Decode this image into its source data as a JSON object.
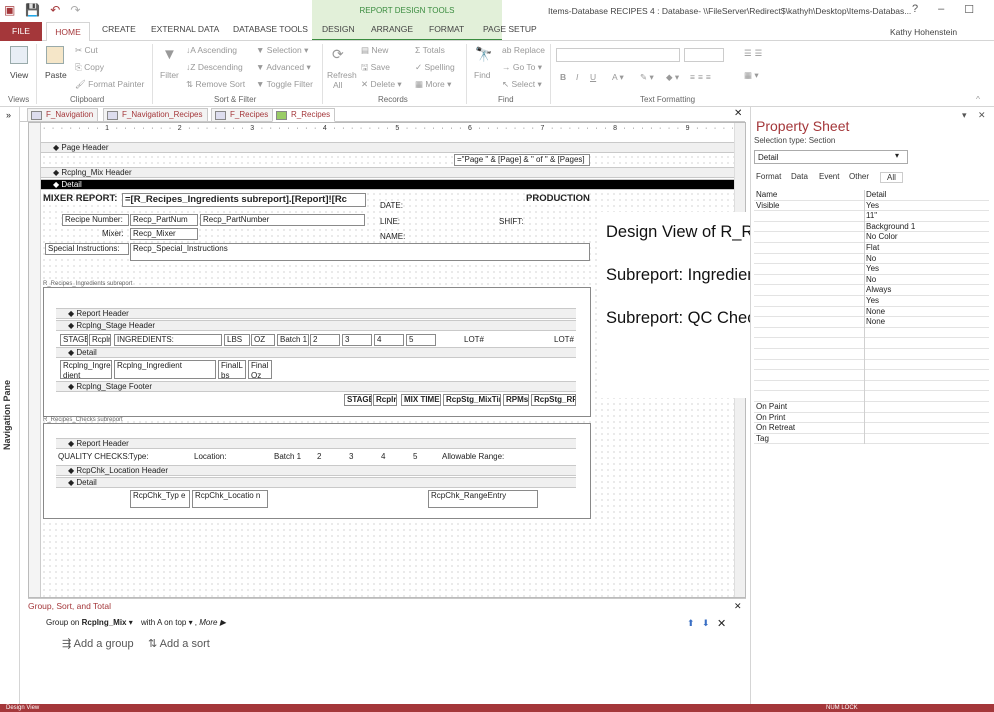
{
  "window": {
    "context_tab_group": "REPORT DESIGN TOOLS",
    "title": "Items-Database RECIPES 4 : Database- \\\\FileServer\\Redirect$\\kathyh\\Desktop\\Items-Databas...",
    "user": "Kathy Hohenstein",
    "controls": [
      "?",
      "–",
      "☐",
      "✕"
    ]
  },
  "ribbon_tabs": [
    "FILE",
    "HOME",
    "CREATE",
    "EXTERNAL DATA",
    "DATABASE TOOLS",
    "DESIGN",
    "ARRANGE",
    "FORMAT",
    "PAGE SETUP"
  ],
  "ribbon": {
    "views": {
      "view": "View",
      "group": "Views"
    },
    "clipboard": {
      "paste": "Paste",
      "cut": "Cut",
      "copy": "Copy",
      "format_painter": "Format Painter",
      "group": "Clipboard"
    },
    "sort_filter": {
      "filter": "Filter",
      "ascending": "Ascending",
      "descending": "Descending",
      "remove_sort": "Remove Sort",
      "selection": "Selection",
      "advanced": "Advanced",
      "toggle_filter": "Toggle Filter",
      "group": "Sort & Filter"
    },
    "records": {
      "refresh": "Refresh",
      "refresh_all": "All",
      "new": "New",
      "save": "Save",
      "delete": "Delete",
      "totals": "Totals",
      "spelling": "Spelling",
      "more": "More",
      "group": "Records"
    },
    "find": {
      "find": "Find",
      "replace": "Replace",
      "goto": "Go To",
      "select": "Select",
      "group": "Find"
    },
    "text_formatting": {
      "group": "Text Formatting"
    }
  },
  "navigation_pane": {
    "label": "Navigation Pane",
    "collapse": "»"
  },
  "document_tabs": [
    {
      "label": "F_Navigation"
    },
    {
      "label": "F_Navigation_Recipes"
    },
    {
      "label": "F_Recipes"
    },
    {
      "label": "R_Recipes",
      "active": true
    }
  ],
  "report": {
    "ruler_top": "· · · · · · · 1 · · · · · · · 2 · · · · · · · 3 · · · · · · · 4 · · · · · · · 5 · · · · · · · 6 · · · · · · · 7 · · · · · · · 8 · · · · · · · 9 · · · · · · · 10",
    "sections": {
      "page_header": "Page Header",
      "mix_header": "Rcplng_Mix Header",
      "detail": "Detail"
    },
    "page_expr": "=\"Page \" & [Page] & \" of \" & [Pages]",
    "mixer_report_label": "MIXER REPORT:",
    "mixer_report_expr": "=[R_Recipes_Ingredients subreport].[Report]![Rc",
    "production_label": "PRODUCTION",
    "date_label": "DATE:",
    "line_label": "LINE:",
    "shift_label": "SHIFT:",
    "name_label": "NAME:",
    "recipe_number_label": "Recipe Number:",
    "recipe_partnum": "Recp_PartNum",
    "recipe_partnumber": "Recp_PartNumber",
    "mixer_label": "Mixer:",
    "recipe_mixer": "Recp_Mixer",
    "special_instructions_label": "Special Instructions:",
    "special_instructions": "Recp_Special_Instructions",
    "ingredients_sub_label": "R_Recipes_Ingredients subreport",
    "ingredients_sub": {
      "report_header": "Report Header",
      "stage_header": "Rcplng_Stage Header",
      "stage_row": [
        "STAGE",
        "Rcplr",
        "INGREDIENTS:",
        "LBS",
        "OZ",
        "Batch 1",
        "2",
        "3",
        "4",
        "5",
        "LOT#",
        "LOT#"
      ],
      "detail": "Detail",
      "detail_row": [
        "Rcplng_Ingre dient",
        "Rcplng_Ingredient",
        "FinalL bs",
        "Final Oz"
      ],
      "stage_footer": "Rcplng_Stage Footer",
      "footer_row": [
        "STAGE",
        "Rcplr",
        "MIX TIME:",
        "RcpStg_MixTim",
        "RPMs:",
        "RcpStg_RPI"
      ]
    },
    "checks_sub_label": "R_Recipes_Checks subreport",
    "checks_sub": {
      "report_header": "Report Header",
      "header_row": [
        "QUALITY CHECKS:",
        "Type:",
        "Location:",
        "Batch 1",
        "2",
        "3",
        "4",
        "5",
        "Allowable Range:"
      ],
      "location_header": "RcpChk_Location Header",
      "detail": "Detail",
      "detail_row": [
        "RcpChk_Typ e",
        "RcpChk_Locatio n",
        "RcpChk_RangeEntry"
      ]
    }
  },
  "overlay": {
    "line1": "Design View of R_Recipes",
    "line2": "Subreport: Ingredients",
    "line3": "Subreport: QC Checks"
  },
  "property_sheet": {
    "title": "Property Sheet",
    "selection_type": "Selection type:  Section",
    "selected": "Detail",
    "tabs": [
      "Format",
      "Data",
      "Event",
      "Other",
      "All"
    ],
    "rows": [
      [
        "Name",
        "Detail"
      ],
      [
        "Visible",
        "Yes"
      ],
      [
        "",
        "11\""
      ],
      [
        "",
        "Background 1"
      ],
      [
        "",
        "No Color"
      ],
      [
        "",
        "Flat"
      ],
      [
        "",
        "No"
      ],
      [
        "",
        "Yes"
      ],
      [
        "",
        "No"
      ],
      [
        "",
        "Always"
      ],
      [
        "",
        "Yes"
      ],
      [
        "",
        "None"
      ],
      [
        "",
        "None"
      ],
      [
        "",
        ""
      ],
      [
        "",
        ""
      ],
      [
        "",
        ""
      ],
      [
        "",
        ""
      ],
      [
        "",
        ""
      ],
      [
        "",
        ""
      ],
      [
        "",
        ""
      ],
      [
        "On Paint",
        ""
      ],
      [
        "On Print",
        ""
      ],
      [
        "On Retreat",
        ""
      ],
      [
        "Tag",
        ""
      ]
    ]
  },
  "group_sort": {
    "title": "Group, Sort, and Total",
    "group_on": "Group on",
    "field": "Rcplng_Mix",
    "order": "with A on top",
    "more": "More ▶",
    "add_group": "Add a group",
    "add_sort": "Add a sort"
  },
  "status": {
    "left": "Design View",
    "right": "NUM LOCK"
  }
}
